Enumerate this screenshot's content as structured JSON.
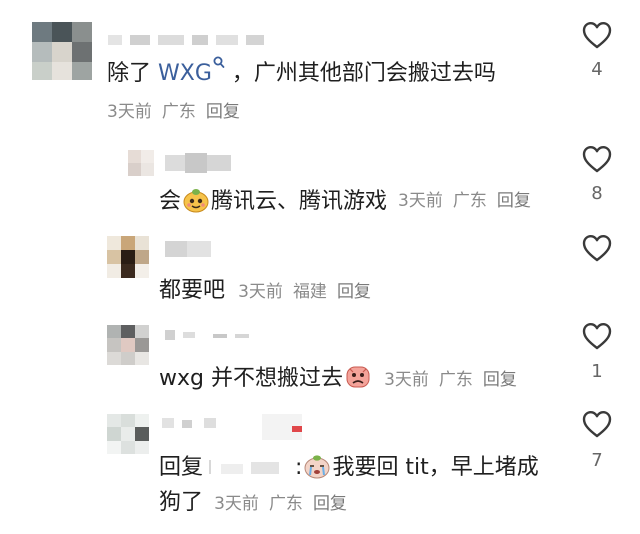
{
  "comments": [
    {
      "text_prefix": "除了 ",
      "highlight": "WXG",
      "text_suffix": " ，广州其他部门会搬过去吗",
      "time": "3天前",
      "location": "广东",
      "reply": "回复",
      "likes": "4"
    },
    {
      "text_prefix": "会",
      "text_suffix": "腾讯云、腾讯游戏",
      "time": "3天前",
      "location": "广东",
      "reply": "回复",
      "likes": "8"
    },
    {
      "text": "都要吧",
      "time": "3天前",
      "location": "福建",
      "reply": "回复",
      "likes": ""
    },
    {
      "text": "wxg 并不想搬过去",
      "time": "3天前",
      "location": "广东",
      "reply": "回复",
      "likes": "1"
    },
    {
      "text_prefix": "回复",
      "text_colon": ":",
      "text_line1": "我要回 tit，早上堵成",
      "text_line2": "狗了",
      "time": "3天前",
      "location": "广东",
      "reply": "回复",
      "likes": "7"
    }
  ],
  "icons": {
    "like": "heart-outline-icon",
    "search": "search-suggest-icon",
    "emoji_smile": "smiling-sticker-icon",
    "emoji_sad": "sad-sticker-icon",
    "emoji_cry": "crying-sticker-icon"
  },
  "colors": {
    "text": "#1f1f1f",
    "meta": "#8a8a8a",
    "highlight": "#3b5f9c"
  }
}
